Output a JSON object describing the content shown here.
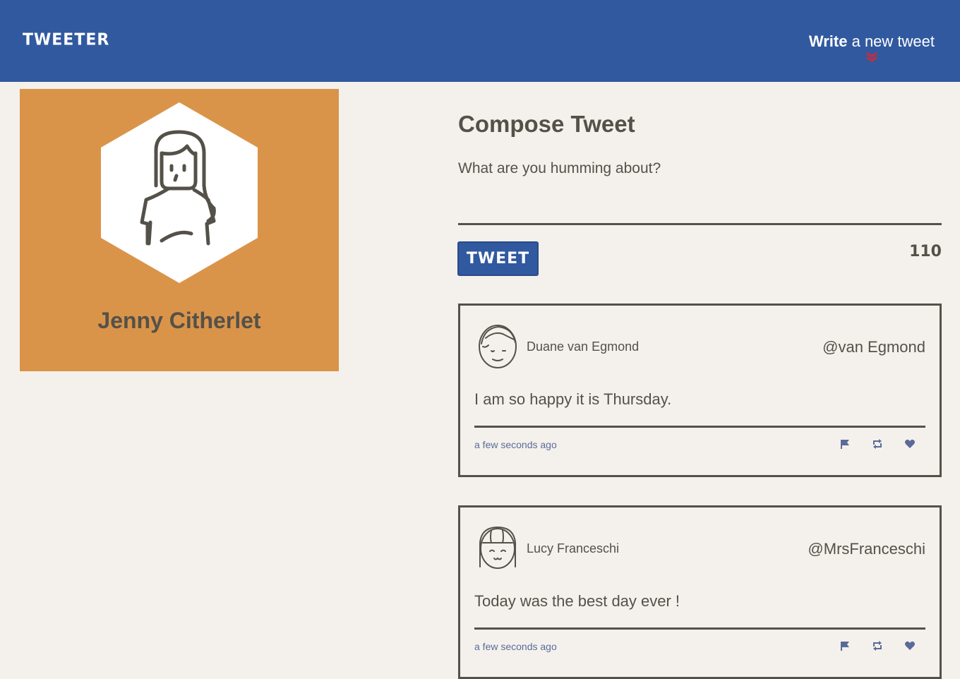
{
  "nav": {
    "brand": "TWEETER",
    "compose_bold": "Write",
    "compose_rest": " a new tweet"
  },
  "profile": {
    "name": "Jenny Citherlet"
  },
  "compose": {
    "title": "Compose Tweet",
    "placeholder": "What are you humming about?",
    "button_label": "TWEET",
    "counter": "110"
  },
  "tweets": [
    {
      "author": "Duane van Egmond",
      "handle": "@van Egmond",
      "text": "I am so happy it is Thursday.",
      "time": "a few seconds ago"
    },
    {
      "author": "Lucy Franceschi",
      "handle": "@MrsFranceschi",
      "text": "Today was the best day ever !",
      "time": "a few seconds ago"
    }
  ],
  "colors": {
    "nav": "#31599f",
    "profile_bg": "#da9449",
    "text": "#545149",
    "chevron": "#d0283c",
    "icon": "#5a6b99"
  },
  "icons": [
    "chevron-down-icon",
    "flag-icon",
    "retweet-icon",
    "heart-icon"
  ]
}
